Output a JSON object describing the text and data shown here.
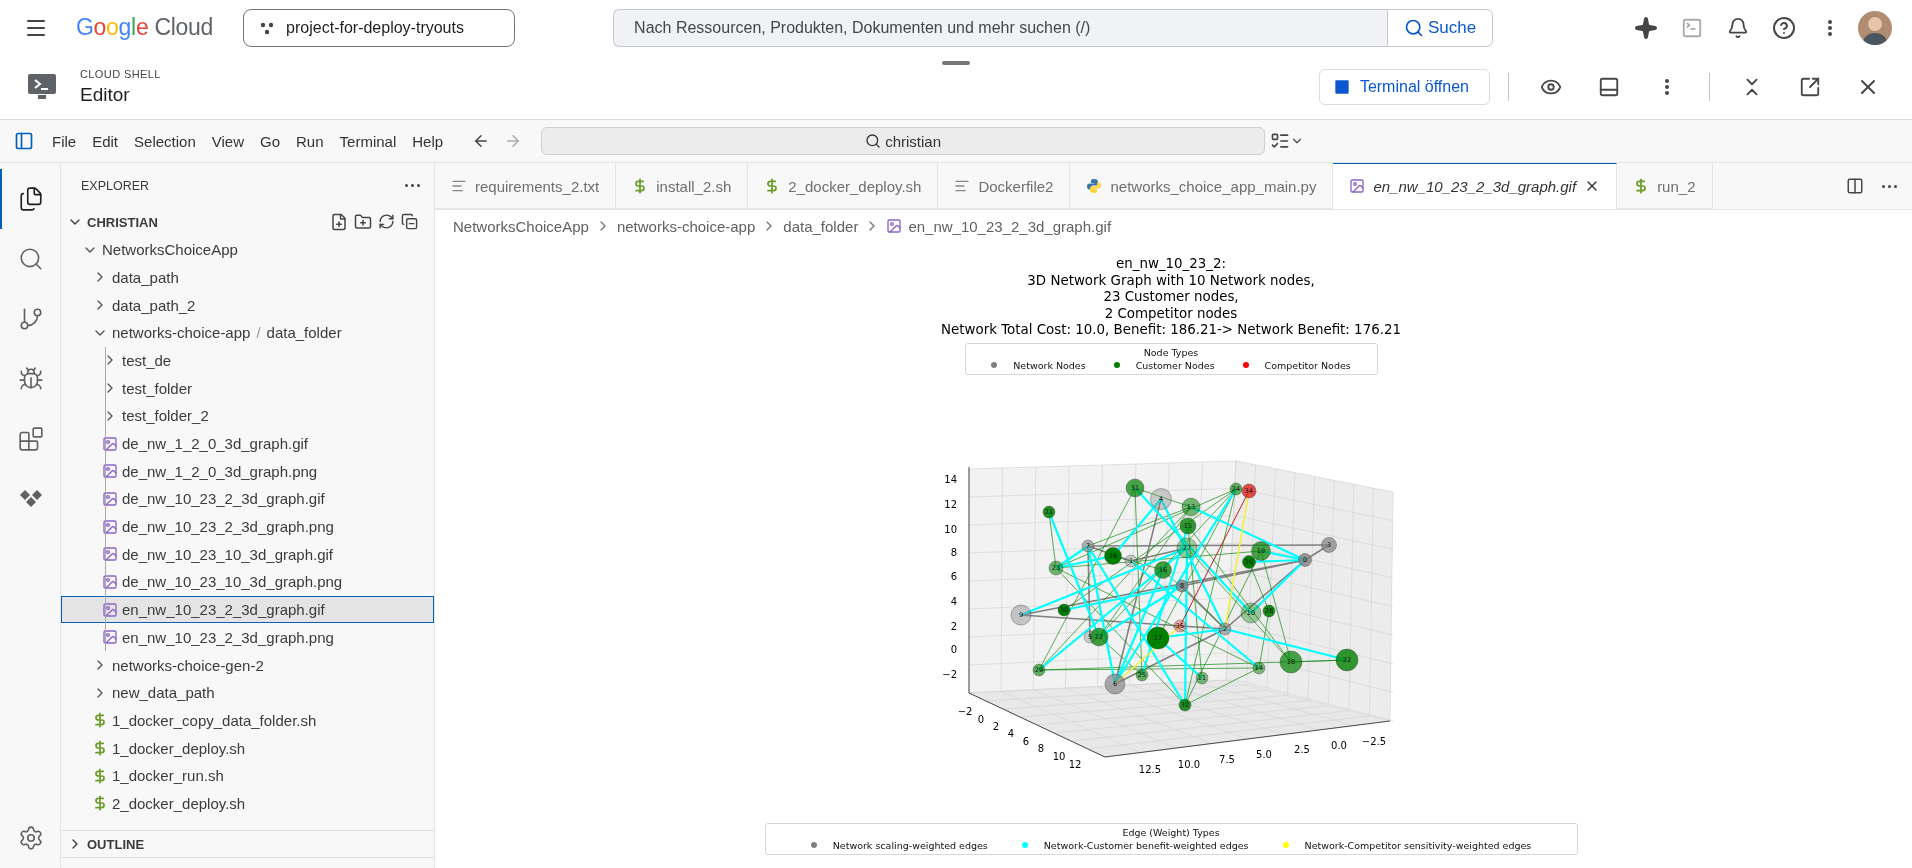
{
  "top_bar": {
    "logo": {
      "brand": "Google",
      "product": "Cloud"
    },
    "project": "project-for-deploy-tryouts",
    "search": {
      "placeholder": "Nach Ressourcen, Produkten, Dokumenten und mehr suchen (/)"
    },
    "search_button": "Suche"
  },
  "shell_bar": {
    "label": "CLOUD SHELL",
    "title": "Editor",
    "terminal_button": "Terminal öffnen"
  },
  "menu_bar": {
    "items": [
      "File",
      "Edit",
      "Selection",
      "View",
      "Go",
      "Run",
      "Terminal",
      "Help"
    ],
    "command_center": "christian"
  },
  "activity_bar": [
    {
      "kind": "explorer",
      "selected": true
    },
    {
      "kind": "search",
      "selected": false
    },
    {
      "kind": "source-control",
      "selected": false
    },
    {
      "kind": "run-debug",
      "selected": false
    },
    {
      "kind": "extensions",
      "selected": false
    },
    {
      "kind": "cloud-code",
      "selected": false
    }
  ],
  "explorer": {
    "title": "EXPLORER",
    "root": {
      "label": "CHRISTIAN",
      "expanded": true,
      "children": [
        {
          "kind": "folder",
          "label": "NetworksChoiceApp",
          "expanded": true,
          "selected": false,
          "children": [
            {
              "kind": "folder",
              "label": "data_path",
              "expanded": false,
              "selected": false
            },
            {
              "kind": "folder",
              "label": "data_path_2",
              "expanded": false,
              "selected": false
            },
            {
              "kind": "folder",
              "label": "networks-choice-app",
              "label_2": "data_folder",
              "separator": "/",
              "expanded": true,
              "selected": false,
              "children": [
                {
                  "kind": "folder",
                  "label": "test_de",
                  "expanded": false,
                  "selected": false
                },
                {
                  "kind": "folder",
                  "label": "test_folder",
                  "expanded": false,
                  "selected": false
                },
                {
                  "kind": "folder",
                  "label": "test_folder_2",
                  "expanded": false,
                  "selected": false
                },
                {
                  "kind": "image",
                  "label": "de_nw_1_2_0_3d_graph.gif",
                  "selected": false
                },
                {
                  "kind": "image",
                  "label": "de_nw_1_2_0_3d_graph.png",
                  "selected": false
                },
                {
                  "kind": "image",
                  "label": "de_nw_10_23_2_3d_graph.gif",
                  "selected": false
                },
                {
                  "kind": "image",
                  "label": "de_nw_10_23_2_3d_graph.png",
                  "selected": false
                },
                {
                  "kind": "image",
                  "label": "de_nw_10_23_10_3d_graph.gif",
                  "selected": false
                },
                {
                  "kind": "image",
                  "label": "de_nw_10_23_10_3d_graph.png",
                  "selected": false
                },
                {
                  "kind": "image",
                  "label": "en_nw_10_23_2_3d_graph.gif",
                  "selected": true
                },
                {
                  "kind": "image",
                  "label": "en_nw_10_23_2_3d_graph.png",
                  "selected": false
                }
              ]
            },
            {
              "kind": "folder",
              "label": "networks-choice-gen-2",
              "expanded": false,
              "selected": false
            },
            {
              "kind": "folder",
              "label": "new_data_path",
              "expanded": false,
              "selected": false
            },
            {
              "kind": "shell",
              "label": "1_docker_copy_data_folder.sh",
              "selected": false
            },
            {
              "kind": "shell",
              "label": "1_docker_deploy.sh",
              "selected": false
            },
            {
              "kind": "shell",
              "label": "1_docker_run.sh",
              "selected": false
            },
            {
              "kind": "shell",
              "label": "2_docker_deploy.sh",
              "selected": false
            }
          ]
        }
      ]
    },
    "sections": [
      {
        "label": "OUTLINE",
        "expanded": false
      }
    ]
  },
  "tabs": [
    {
      "label": "requirements_2.txt",
      "kind": "text",
      "selected": false
    },
    {
      "label": "install_2.sh",
      "kind": "shell",
      "selected": false
    },
    {
      "label": "2_docker_deploy.sh",
      "kind": "shell",
      "selected": false
    },
    {
      "label": "Dockerfile2",
      "kind": "text",
      "selected": false
    },
    {
      "label": "networks_choice_app_main.py",
      "kind": "python",
      "selected": false
    },
    {
      "label": "en_nw_10_23_2_3d_graph.gif",
      "kind": "image",
      "selected": true
    },
    {
      "label": "run_2",
      "kind": "shell",
      "selected": false
    }
  ],
  "breadcrumb": [
    {
      "label": "NetworksChoiceApp",
      "kind": "folder"
    },
    {
      "label": "networks-choice-app",
      "kind": "folder"
    },
    {
      "label": "data_folder",
      "kind": "folder"
    },
    {
      "label": "en_nw_10_23_2_3d_graph.gif",
      "kind": "image"
    }
  ],
  "image": {
    "title_lines": [
      "en_nw_10_23_2:",
      "3D Network Graph with 10 Network nodes,",
      "23 Customer nodes,",
      "2 Competitor nodes",
      "Network Total Cost: 10.0, Benefit: 186.21-> Network Benefit: 176.21"
    ],
    "node_legend": {
      "title": "Node Types",
      "items": [
        {
          "label": "Network Nodes",
          "color": "#808080"
        },
        {
          "label": "Customer Nodes",
          "color": "#008000"
        },
        {
          "label": "Competitor Nodes",
          "color": "#ff0000"
        }
      ]
    },
    "plot": {
      "z_ticks": [
        "14",
        "12",
        "10",
        "8",
        "6",
        "4",
        "2",
        "0",
        "−2"
      ],
      "y_ticks": [
        "−2",
        "0",
        "2",
        "4",
        "6",
        "8",
        "10",
        "12"
      ],
      "x_ticks": [
        "12.5",
        "10.0",
        "7.5",
        "5.0",
        "2.5",
        "0.0",
        "−2.5"
      ],
      "nodes": [
        {
          "label": "31",
          "kind": "customer"
        },
        {
          "label": "4",
          "kind": "network"
        },
        {
          "label": "13",
          "kind": "customer"
        },
        {
          "label": "15",
          "kind": "customer"
        },
        {
          "label": "24",
          "kind": "customer"
        },
        {
          "label": "34",
          "kind": "competitor"
        },
        {
          "label": "21",
          "kind": "customer"
        },
        {
          "label": "7",
          "kind": "network"
        },
        {
          "label": "26",
          "kind": "customer"
        },
        {
          "label": "1",
          "kind": "network"
        },
        {
          "label": "27",
          "kind": "customer"
        },
        {
          "label": "19",
          "kind": "customer"
        },
        {
          "label": "20",
          "kind": "customer"
        },
        {
          "label": "3",
          "kind": "network"
        },
        {
          "label": "0",
          "kind": "network"
        },
        {
          "label": "23",
          "kind": "customer"
        },
        {
          "label": "16",
          "kind": "customer"
        },
        {
          "label": "8",
          "kind": "network"
        },
        {
          "label": "9",
          "kind": "network"
        },
        {
          "label": "30",
          "kind": "customer"
        },
        {
          "label": "10",
          "kind": "customer"
        },
        {
          "label": "28",
          "kind": "customer"
        },
        {
          "label": "35",
          "kind": "competitor"
        },
        {
          "label": "5",
          "kind": "network"
        },
        {
          "label": "12",
          "kind": "customer"
        },
        {
          "label": "17",
          "kind": "customer"
        },
        {
          "label": "2",
          "kind": "network"
        },
        {
          "label": "22",
          "kind": "customer"
        },
        {
          "label": "18",
          "kind": "customer"
        },
        {
          "label": "14",
          "kind": "customer"
        },
        {
          "label": "29",
          "kind": "customer"
        },
        {
          "label": "25",
          "kind": "customer"
        },
        {
          "label": "11",
          "kind": "customer"
        },
        {
          "label": "6",
          "kind": "network"
        },
        {
          "label": "32",
          "kind": "customer"
        }
      ]
    },
    "edge_legend": {
      "title": "Edge (Weight) Types",
      "items": [
        {
          "label": "Network scaling-weighted edges",
          "color": "#808080"
        },
        {
          "label": "Network-Customer benefit-weighted edges",
          "color": "#00ffff"
        },
        {
          "label": "Network-Competitor sensitivity-weighted edges",
          "color": "#ffff00"
        }
      ]
    }
  }
}
